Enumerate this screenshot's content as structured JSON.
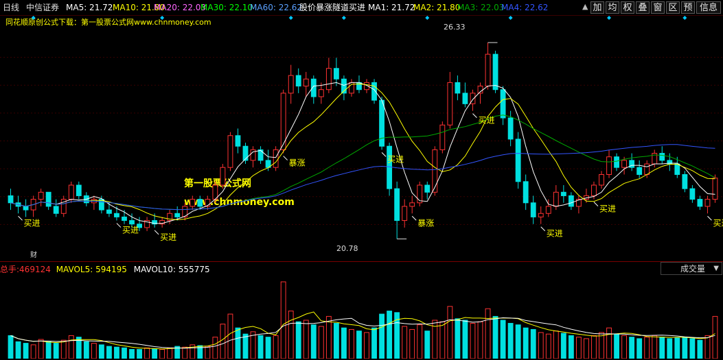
{
  "header": {
    "period": "日线",
    "stock_name": "中信证券",
    "ma_items": [
      {
        "label": "MA5: 21.72",
        "color": "#ffffff"
      },
      {
        "label": "MA10: 21.80",
        "color": "#ffff00"
      },
      {
        "label": "MA20: 22.03",
        "color": "#ff66ff"
      },
      {
        "label": "MA30: 22.10",
        "color": "#00ff00"
      },
      {
        "label": "MA60: 22.62",
        "color": "#5aa0ff"
      }
    ],
    "indicator_name": "股价暴涨隧道买进",
    "indicator_items": [
      {
        "label": "MA1: 21.72",
        "color": "#ffffff"
      },
      {
        "label": "MA2: 21.80",
        "color": "#ffff00"
      },
      {
        "label": "MA3: 22.03",
        "color": "#00aa00"
      },
      {
        "label": "MA4: 22.62",
        "color": "#3355ff"
      }
    ],
    "buttons": [
      "加",
      "均",
      "权",
      "叠",
      "窗",
      "区",
      "预",
      "信息"
    ],
    "up_icon": "triangle-up-icon"
  },
  "watermark": {
    "top_text": "同花顺原创公式下载：第一股票公式网www.chnmoney.com",
    "site_name": "第一股票公式网",
    "site_url": "www.chnmoney.com"
  },
  "price_annotations": {
    "high_label": "26.33",
    "low_label": "20.78",
    "fin_label": "财"
  },
  "signals": {
    "buy_label": "买进",
    "surge_label": "暴涨"
  },
  "volume": {
    "label_total": "总手:",
    "total_value": "469124",
    "mavol5": "MAVOL5: 594195",
    "mavol10": "MAVOL10: 555775",
    "dropdown": "成交量"
  },
  "colors": {
    "up": "#ff3232",
    "down": "#00e0e0",
    "ma_white": "#ffffff",
    "ma_yellow": "#ffff00",
    "ma_green": "#00aa00",
    "ma_blue": "#3355ff",
    "signal_text": "#ffff00",
    "site_name_color": "#ffff00",
    "diamond": "#00c8ff"
  },
  "chart_data": {
    "type": "candlestick",
    "price_range": [
      20.4,
      26.7
    ],
    "high_value": 26.33,
    "low_value": 20.78,
    "candles": [
      [
        22.0,
        22.2,
        21.6,
        21.8
      ],
      [
        21.8,
        22.0,
        21.5,
        21.7
      ],
      [
        21.7,
        21.9,
        21.4,
        21.6
      ],
      [
        21.6,
        22.0,
        21.4,
        21.9
      ],
      [
        21.9,
        22.2,
        21.7,
        22.1
      ],
      [
        22.1,
        22.1,
        21.6,
        21.7
      ],
      [
        21.7,
        21.9,
        21.4,
        21.5
      ],
      [
        21.5,
        22.0,
        21.4,
        21.9
      ],
      [
        21.9,
        22.4,
        21.8,
        22.3
      ],
      [
        22.3,
        22.4,
        21.9,
        22.0
      ],
      [
        22.0,
        22.1,
        21.7,
        21.8
      ],
      [
        21.8,
        22.0,
        21.6,
        21.9
      ],
      [
        21.9,
        22.0,
        21.5,
        21.6
      ],
      [
        21.6,
        21.8,
        21.4,
        21.5
      ],
      [
        21.5,
        21.7,
        21.3,
        21.4
      ],
      [
        21.4,
        21.6,
        21.2,
        21.3
      ],
      [
        21.3,
        21.5,
        21.1,
        21.2
      ],
      [
        21.2,
        21.4,
        21.0,
        21.1
      ],
      [
        21.1,
        21.4,
        21.0,
        21.3
      ],
      [
        21.3,
        21.5,
        21.1,
        21.2
      ],
      [
        21.2,
        21.4,
        21.1,
        21.3
      ],
      [
        21.3,
        21.6,
        21.2,
        21.5
      ],
      [
        21.5,
        21.7,
        21.3,
        21.4
      ],
      [
        21.4,
        21.8,
        21.3,
        21.7
      ],
      [
        21.7,
        22.0,
        21.6,
        21.9
      ],
      [
        21.9,
        22.0,
        21.6,
        21.7
      ],
      [
        21.7,
        22.0,
        21.6,
        21.9
      ],
      [
        21.9,
        22.4,
        21.8,
        22.3
      ],
      [
        22.3,
        22.9,
        22.2,
        22.8
      ],
      [
        22.8,
        23.8,
        22.7,
        23.7
      ],
      [
        23.7,
        23.9,
        23.2,
        23.4
      ],
      [
        23.4,
        23.5,
        22.9,
        23.0
      ],
      [
        23.0,
        23.4,
        22.8,
        23.3
      ],
      [
        23.3,
        23.4,
        22.9,
        23.0
      ],
      [
        23.0,
        23.3,
        22.7,
        22.8
      ],
      [
        22.8,
        23.4,
        22.7,
        23.3
      ],
      [
        23.3,
        25.0,
        23.2,
        24.9
      ],
      [
        24.9,
        25.7,
        24.6,
        25.4
      ],
      [
        25.4,
        25.6,
        24.9,
        25.1
      ],
      [
        25.1,
        25.5,
        24.8,
        25.3
      ],
      [
        25.3,
        25.4,
        24.6,
        24.8
      ],
      [
        24.8,
        25.2,
        24.6,
        25.0
      ],
      [
        25.0,
        25.9,
        24.9,
        25.6
      ],
      [
        25.6,
        25.9,
        25.1,
        25.3
      ],
      [
        25.3,
        25.4,
        24.7,
        24.9
      ],
      [
        24.9,
        25.3,
        24.8,
        25.2
      ],
      [
        25.2,
        25.4,
        24.9,
        25.0
      ],
      [
        25.0,
        25.3,
        24.9,
        25.2
      ],
      [
        25.2,
        25.3,
        24.6,
        24.7
      ],
      [
        24.7,
        24.8,
        23.3,
        23.4
      ],
      [
        23.4,
        23.5,
        22.0,
        22.2
      ],
      [
        22.2,
        22.4,
        20.78,
        21.3
      ],
      [
        21.3,
        21.9,
        21.1,
        21.7
      ],
      [
        21.7,
        22.0,
        21.5,
        21.8
      ],
      [
        21.8,
        22.4,
        21.7,
        22.3
      ],
      [
        22.3,
        22.4,
        21.9,
        22.1
      ],
      [
        22.1,
        23.4,
        22.0,
        23.3
      ],
      [
        23.3,
        24.1,
        23.2,
        24.0
      ],
      [
        24.0,
        25.5,
        23.9,
        25.2
      ],
      [
        25.2,
        25.4,
        24.7,
        24.9
      ],
      [
        24.9,
        25.2,
        24.5,
        24.6
      ],
      [
        24.6,
        25.0,
        24.4,
        24.9
      ],
      [
        24.9,
        25.2,
        24.6,
        25.1
      ],
      [
        25.1,
        26.33,
        25.0,
        26.0
      ],
      [
        26.0,
        26.1,
        24.9,
        25.0
      ],
      [
        25.0,
        25.1,
        24.0,
        24.2
      ],
      [
        24.2,
        24.4,
        23.4,
        23.6
      ],
      [
        23.6,
        23.8,
        22.2,
        22.4
      ],
      [
        22.4,
        22.6,
        21.6,
        21.8
      ],
      [
        21.8,
        22.0,
        21.2,
        21.4
      ],
      [
        21.4,
        21.7,
        21.2,
        21.5
      ],
      [
        21.5,
        21.9,
        21.4,
        21.7
      ],
      [
        21.7,
        22.3,
        21.6,
        22.1
      ],
      [
        22.1,
        22.3,
        21.8,
        22.0
      ],
      [
        22.0,
        22.1,
        21.6,
        21.7
      ],
      [
        21.7,
        22.0,
        21.5,
        21.9
      ],
      [
        21.9,
        22.2,
        21.8,
        22.0
      ],
      [
        22.0,
        22.4,
        21.9,
        22.3
      ],
      [
        22.3,
        22.7,
        22.2,
        22.6
      ],
      [
        22.6,
        23.3,
        22.5,
        23.1
      ],
      [
        23.1,
        23.2,
        22.7,
        22.8
      ],
      [
        22.8,
        23.1,
        22.6,
        23.0
      ],
      [
        23.0,
        23.2,
        22.7,
        22.8
      ],
      [
        22.8,
        23.0,
        22.5,
        22.6
      ],
      [
        22.6,
        23.0,
        22.5,
        22.9
      ],
      [
        22.9,
        23.3,
        22.8,
        23.2
      ],
      [
        23.2,
        23.4,
        22.9,
        23.0
      ],
      [
        23.0,
        23.2,
        22.7,
        22.9
      ],
      [
        22.9,
        23.1,
        22.5,
        22.6
      ],
      [
        22.6,
        22.7,
        22.1,
        22.2
      ],
      [
        22.2,
        22.3,
        21.8,
        21.9
      ],
      [
        21.9,
        22.0,
        21.6,
        21.7
      ],
      [
        21.7,
        22.0,
        21.5,
        21.9
      ],
      [
        21.9,
        22.6,
        21.8,
        22.5
      ]
    ],
    "volumes": [
      0.3,
      0.22,
      0.2,
      0.18,
      0.25,
      0.22,
      0.2,
      0.24,
      0.3,
      0.28,
      0.22,
      0.2,
      0.18,
      0.16,
      0.15,
      0.14,
      0.12,
      0.12,
      0.14,
      0.13,
      0.12,
      0.14,
      0.16,
      0.15,
      0.18,
      0.17,
      0.16,
      0.28,
      0.45,
      0.58,
      0.4,
      0.32,
      0.35,
      0.3,
      0.28,
      0.3,
      1.0,
      0.62,
      0.48,
      0.5,
      0.44,
      0.42,
      0.55,
      0.46,
      0.4,
      0.38,
      0.36,
      0.34,
      0.4,
      0.58,
      0.62,
      0.6,
      0.42,
      0.38,
      0.44,
      0.36,
      0.5,
      0.48,
      0.68,
      0.52,
      0.5,
      0.46,
      0.48,
      0.65,
      0.55,
      0.5,
      0.46,
      0.44,
      0.4,
      0.38,
      0.34,
      0.32,
      0.36,
      0.33,
      0.3,
      0.28,
      0.26,
      0.3,
      0.34,
      0.4,
      0.32,
      0.3,
      0.28,
      0.26,
      0.28,
      0.3,
      0.28,
      0.26,
      0.27,
      0.28,
      0.26,
      0.24,
      0.3,
      0.55
    ]
  }
}
